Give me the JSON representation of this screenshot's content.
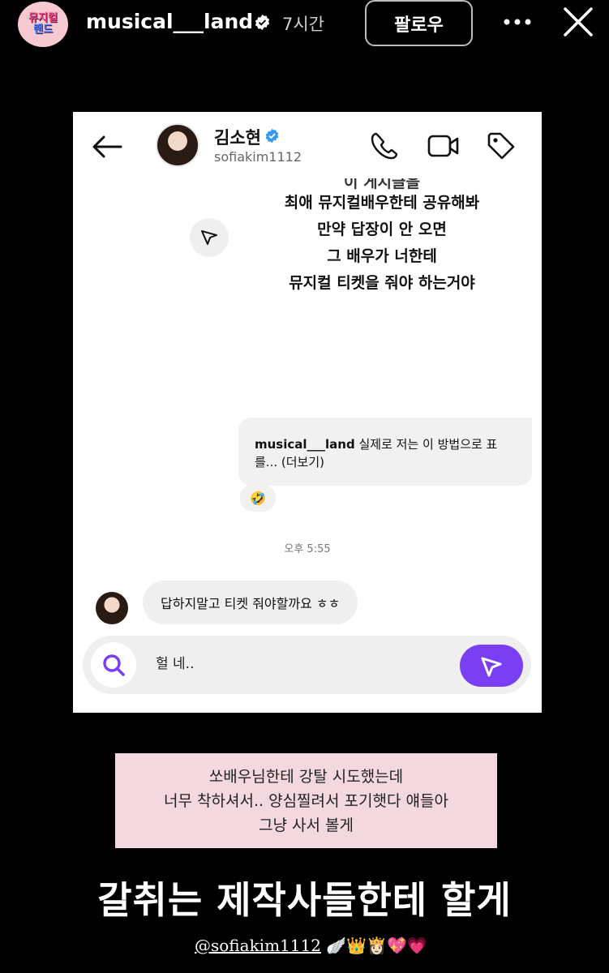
{
  "story": {
    "avatar_line1": "뮤지컬",
    "avatar_line2": "랜드",
    "username": "musical___land",
    "time": "7시간",
    "follow_label": "팔로우"
  },
  "dm": {
    "name": "김소현",
    "handle": "sofiakim1112",
    "post_lines": [
      "이 게시글을",
      "최애 뮤지컬배우한테 공유해봐",
      "만약 답장이 안 오면",
      "그 배우가 너한테",
      "뮤지컬 티켓을 줘야 하는거야"
    ],
    "reply_user": "musical___land",
    "reply_text": " 실제로 저는 이 방법으로 표를... (더보기)",
    "reaction": "🤣",
    "timestamp": "오후 5:55",
    "message": "답하지말고 티켓 줘야할까요 ㅎㅎ",
    "composer_value": "헐 네.."
  },
  "caption": {
    "lines": [
      "쏘배우님한테 강탈 시도했는데",
      "너무 착하셔서.. 양심찔려서 포기햇다 얘들아",
      "그냥 사서 볼게"
    ]
  },
  "big_text": "갈취는 제작사들한테 할게",
  "mention": {
    "handle": "@sofiakim1112",
    "emojis": "🪽👑👸🏻💖💗"
  },
  "colors": {
    "accent": "#7a3ff2",
    "verified": "#3897f0",
    "caption_bg": "#f3d9df"
  },
  "icons": [
    "verified-icon",
    "more-icon",
    "close-icon",
    "back-arrow-icon",
    "phone-icon",
    "video-icon",
    "tag-icon",
    "share-icon",
    "search-icon",
    "send-icon"
  ]
}
